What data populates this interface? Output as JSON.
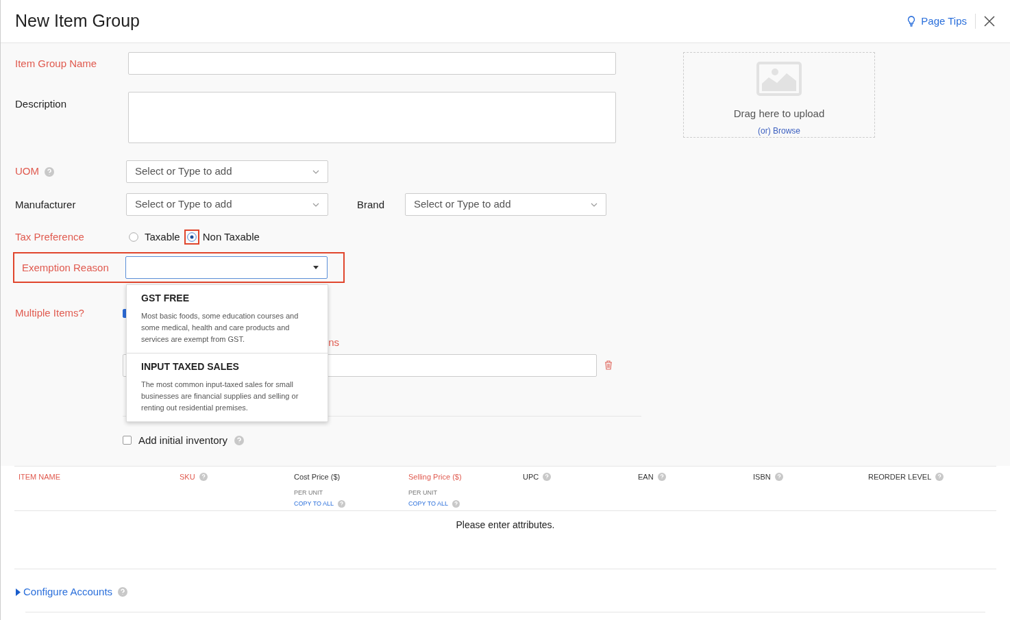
{
  "header": {
    "title": "New Item Group",
    "page_tips": "Page Tips"
  },
  "form": {
    "item_group_name": {
      "label": "Item Group Name",
      "required": true
    },
    "description": {
      "label": "Description",
      "required": false
    },
    "uom": {
      "label": "UOM",
      "required": true,
      "placeholder": "Select or Type to add"
    },
    "manufacturer": {
      "label": "Manufacturer",
      "required": false,
      "placeholder": "Select or Type to add"
    },
    "brand": {
      "label": "Brand",
      "required": false,
      "placeholder": "Select or Type to add"
    },
    "tax_preference": {
      "label": "Tax Preference",
      "required": true,
      "options": [
        {
          "label": "Taxable",
          "selected": false
        },
        {
          "label": "Non Taxable",
          "selected": true
        }
      ]
    },
    "exemption_reason": {
      "label": "Exemption Reason",
      "required": true,
      "highlighted": true,
      "expanded": true,
      "options": [
        {
          "title": "GST FREE",
          "text": "Most basic foods, some education courses and some medical, health and care products and services are exempt from GST."
        },
        {
          "title": "INPUT TAXED SALES",
          "text": "The most common input-taxed sales for small businesses are financial supplies and selling or renting out residential premises."
        }
      ]
    },
    "multiple_items": {
      "label": "Multiple Items?",
      "required": true,
      "checked": true,
      "attribute_label_end": "ns"
    },
    "initial_inventory": {
      "label": "Add initial inventory",
      "checked": false
    }
  },
  "upload": {
    "text": "Drag here to upload",
    "prefix": "(or)",
    "link": "Browse"
  },
  "table": {
    "columns": [
      {
        "label": "ITEM NAME",
        "required": true,
        "help": false
      },
      {
        "label": "SKU",
        "required": true,
        "help": true
      },
      {
        "label": "Cost Price ($)",
        "required": false,
        "help": false,
        "sub": "PER UNIT",
        "copy": "COPY TO ALL"
      },
      {
        "label": "Selling Price ($)",
        "required": true,
        "help": false,
        "sub": "PER UNIT",
        "copy": "COPY TO ALL"
      },
      {
        "label": "UPC",
        "required": false,
        "help": true
      },
      {
        "label": "EAN",
        "required": false,
        "help": true
      },
      {
        "label": "ISBN",
        "required": false,
        "help": true
      },
      {
        "label": "REORDER LEVEL",
        "required": false,
        "help": true
      }
    ],
    "empty_text": "Please enter attributes."
  },
  "configure_accounts": {
    "label": "Configure Accounts",
    "expanded": false
  }
}
